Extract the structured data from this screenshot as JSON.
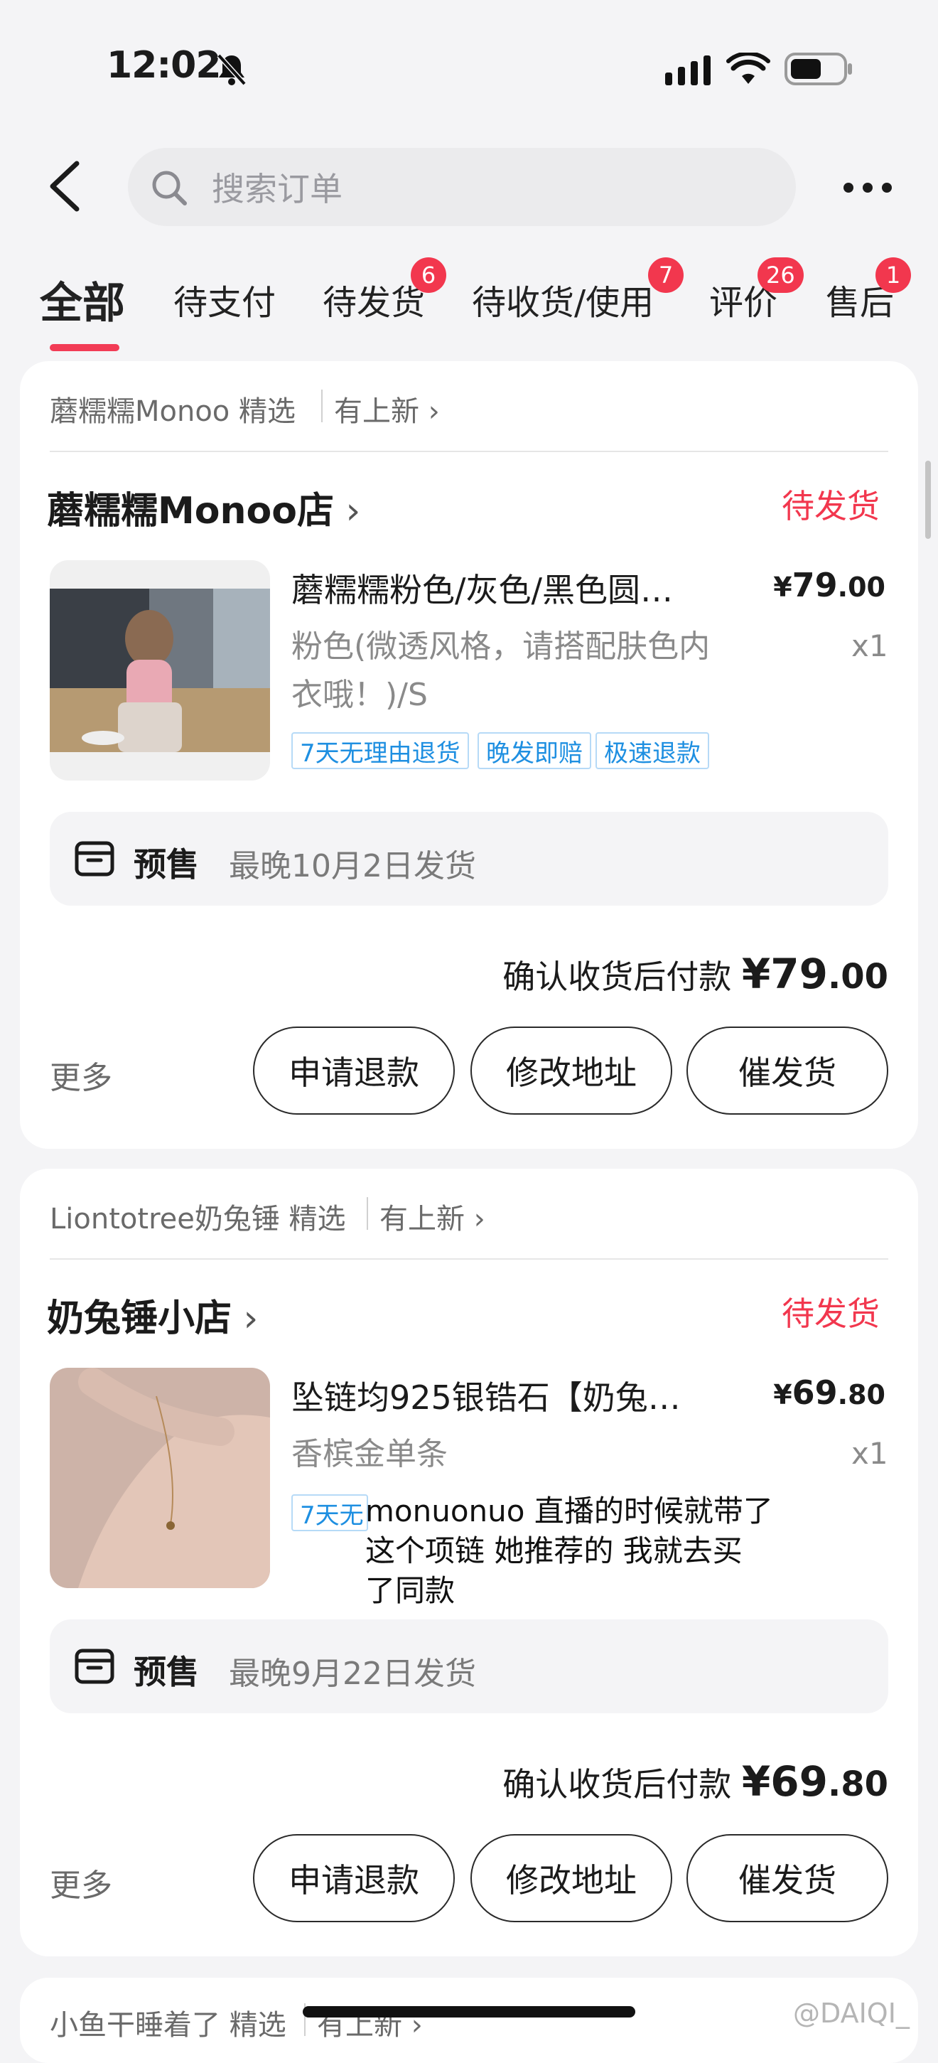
{
  "status_bar": {
    "time": "12:02"
  },
  "header": {
    "search_placeholder": "搜索订单"
  },
  "tabs": [
    {
      "label": "全部",
      "active": true
    },
    {
      "label": "待支付"
    },
    {
      "label": "待发货",
      "badge": "6"
    },
    {
      "label": "待收货/使用",
      "badge": "7"
    },
    {
      "label": "评价",
      "badge": "26"
    },
    {
      "label": "售后",
      "badge": "1"
    }
  ],
  "orders": [
    {
      "source": "蘑糯糯Monoo 精选",
      "new_label": "有上新",
      "shop": "蘑糯糯Monoo店",
      "status": "待发货",
      "product_title": "蘑糯糯粉色/灰色/黑色圆…",
      "price_int": "79",
      "price_dec": ".00",
      "spec_line1": "粉色(微透风格，请搭配肤色内",
      "spec_line2": "衣哦！)/S",
      "qty": "x1",
      "tags": [
        "7天无理由退货",
        "晚发即赔",
        "极速退款"
      ],
      "presale_label": "预售",
      "presale_text": "最晚10月2日发货",
      "total_label": "确认收货后付款",
      "total_int": "79",
      "total_dec": ".00",
      "more": "更多",
      "buttons": [
        "申请退款",
        "修改地址",
        "催发货"
      ]
    },
    {
      "source": "Liontotree奶兔锤 精选",
      "new_label": "有上新",
      "shop": "奶兔锤小店",
      "status": "待发货",
      "product_title": "坠链均925银锆石【奶兔…",
      "price_int": "69",
      "price_dec": ".80",
      "spec_line1": "香槟金单条",
      "qty": "x1",
      "tag_partial": "7天无",
      "presale_label": "预售",
      "presale_text": "最晚9月22日发货",
      "total_label": "确认收货后付款",
      "total_int": "69",
      "total_dec": ".80",
      "more": "更多",
      "buttons": [
        "申请退款",
        "修改地址",
        "催发货"
      ]
    },
    {
      "source": "小鱼干睡着了 精选",
      "new_label": "有上新"
    }
  ],
  "overlay_caption": [
    "monuonuo 直播的时候就带了",
    "这个项链 她推荐的 我就去买",
    "了同款"
  ],
  "watermark": "@DAIQI_",
  "currency": "¥",
  "colors": {
    "accent": "#f2374e",
    "tag_blue": "#1e8fe1"
  }
}
